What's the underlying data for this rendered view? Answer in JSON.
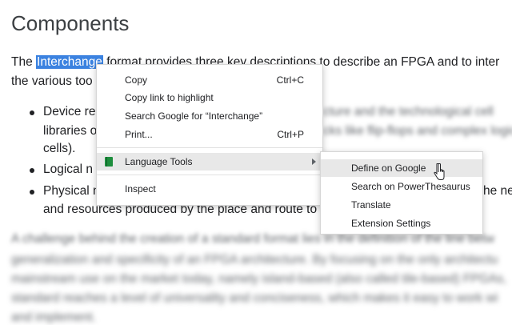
{
  "article": {
    "heading": "Components",
    "para1_before": "The ",
    "para1_highlight": "Interchange",
    "para1_after": " format provides three key descriptions to describe an FPGA and to inter",
    "para1_line2": "the various too",
    "bullets": [
      {
        "line1": "Device re",
        "line1_blur": "cture and the technological cell",
        "line2": "libraries o",
        "line2_blur": "cks like flip-flops and complex logic",
        "line3": "cells)."
      },
      {
        "line1": "Logical n",
        "line1_blur": ""
      },
      {
        "line1": "Physical n",
        "line1_blur": "",
        "line1_tail": "he ne",
        "line2": "and resources produced by the place and route to"
      }
    ],
    "para2_lines": [
      "A challenge behind the creation of a standard format lies in the definition of the line betw",
      "generalization and specificity of an FPGA architecture. By focusing on the only architectu",
      "mainstream use on the market today, namely island-based (also called tile-based) FPGAs,",
      "standard reaches a level of universality and conciseness, which makes it easy to work wi",
      "and implement."
    ]
  },
  "context_menu": {
    "items": [
      {
        "label": "Copy",
        "shortcut": "Ctrl+C"
      },
      {
        "label": "Copy link to highlight",
        "shortcut": ""
      },
      {
        "label": "Search Google for “Interchange”",
        "shortcut": ""
      },
      {
        "label": "Print...",
        "shortcut": "Ctrl+P"
      },
      {
        "label": "Language Tools",
        "shortcut": "",
        "icon": "book-icon",
        "has_submenu": true
      },
      {
        "label": "Inspect",
        "shortcut": ""
      }
    ]
  },
  "submenu": {
    "items": [
      {
        "label": "Define on Google"
      },
      {
        "label": "Search on PowerThesaurus"
      },
      {
        "label": "Translate"
      },
      {
        "label": "Extension Settings"
      }
    ]
  },
  "colors": {
    "selection": "#3b82e0",
    "hover": "#e8e8e8",
    "extension_icon": "#1e8e3e"
  }
}
